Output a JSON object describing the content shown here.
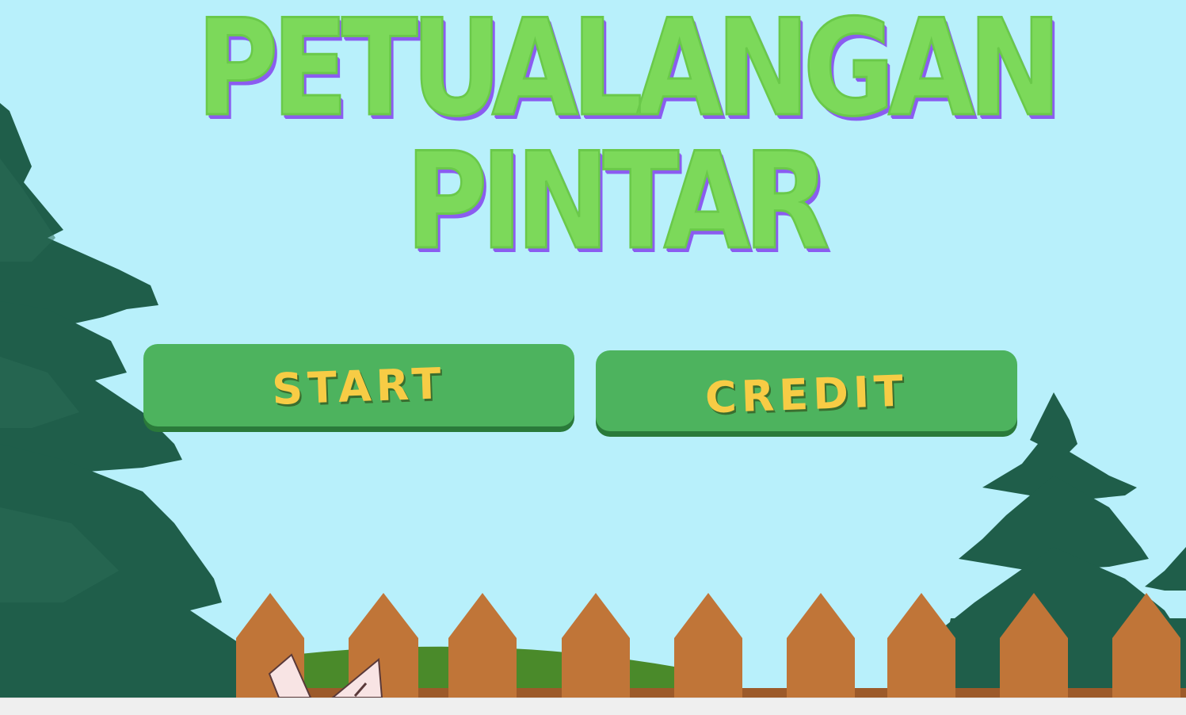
{
  "title": {
    "line1": "PETUALANGAN",
    "line2": "PINTAR"
  },
  "menu": {
    "start_label": "START",
    "credit_label": "CREDIT"
  },
  "colors": {
    "sky": "#b8f0fb",
    "title_fill": "#7cd95a",
    "title_shadow": "#8b5cf0",
    "button_fill": "#4db35e",
    "button_shadow": "#2a7a3a",
    "button_text": "#f7cc45",
    "tree": "#1f5e4a",
    "fence": "#c07538",
    "grass": "#4a8a2a"
  },
  "icons": [
    "pine-tree-icon",
    "fence-icon",
    "cat-ears-icon"
  ]
}
